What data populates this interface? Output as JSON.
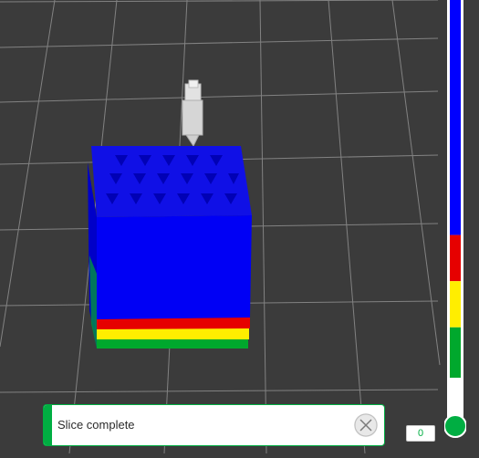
{
  "colors": {
    "background": "#3b3b3b",
    "grid": "#8a8a8a",
    "accent": "#00ae42",
    "layer_blue": "#0000ff",
    "layer_red": "#e60000",
    "layer_yellow": "#ffee00",
    "layer_green": "#00a82d"
  },
  "layer_slider": {
    "value": "0",
    "segments": [
      {
        "color": "#0000ff",
        "fraction": 0.56
      },
      {
        "color": "#e60000",
        "fraction": 0.11
      },
      {
        "color": "#ffee00",
        "fraction": 0.11
      },
      {
        "color": "#00a82d",
        "fraction": 0.12
      }
    ]
  },
  "notification": {
    "message": "Slice complete",
    "close_icon": "close-icon"
  }
}
